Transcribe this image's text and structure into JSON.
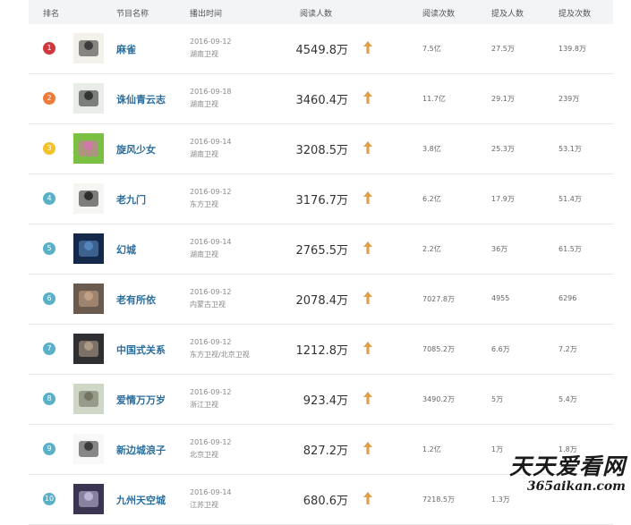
{
  "header": {
    "rank": "排名",
    "name": "节目名称",
    "air_time": "播出时间",
    "readers": "阅读人数",
    "reads": "阅读次数",
    "mentioners": "提及人数",
    "mentions": "提及次数"
  },
  "rows": [
    {
      "rank": "1",
      "name": "麻雀",
      "date": "2016-09-12",
      "channel": "湖南卫视",
      "readers": "4549.8万",
      "reads": "7.5亿",
      "mentioners": "27.5万",
      "mentions": "139.8万",
      "rank_color": "#d0383f"
    },
    {
      "rank": "2",
      "name": "诛仙青云志",
      "date": "2016-09-18",
      "channel": "湖南卫视",
      "readers": "3460.4万",
      "reads": "11.7亿",
      "mentioners": "29.1万",
      "mentions": "239万",
      "rank_color": "#ef7b3a"
    },
    {
      "rank": "3",
      "name": "旋风少女",
      "date": "2016-09-14",
      "channel": "湖南卫视",
      "readers": "3208.5万",
      "reads": "3.8亿",
      "mentioners": "25.3万",
      "mentions": "53.1万",
      "rank_color": "#f3c12b"
    },
    {
      "rank": "4",
      "name": "老九门",
      "date": "2016-09-12",
      "channel": "东方卫视",
      "readers": "3176.7万",
      "reads": "6.2亿",
      "mentioners": "17.9万",
      "mentions": "51.4万",
      "rank_color": "#5ab0c9"
    },
    {
      "rank": "5",
      "name": "幻城",
      "date": "2016-09-14",
      "channel": "湖南卫视",
      "readers": "2765.5万",
      "reads": "2.2亿",
      "mentioners": "36万",
      "mentions": "61.5万",
      "rank_color": "#5ab0c9"
    },
    {
      "rank": "6",
      "name": "老有所依",
      "date": "2016-09-12",
      "channel": "内蒙古卫视",
      "readers": "2078.4万",
      "reads": "7027.8万",
      "mentioners": "4955",
      "mentions": "6296",
      "rank_color": "#5ab0c9"
    },
    {
      "rank": "7",
      "name": "中国式关系",
      "date": "2016-09-12",
      "channel": "东方卫视/北京卫视",
      "readers": "1212.8万",
      "reads": "7085.2万",
      "mentioners": "6.6万",
      "mentions": "7.2万",
      "rank_color": "#5ab0c9"
    },
    {
      "rank": "8",
      "name": "爱情万万岁",
      "date": "2016-09-12",
      "channel": "浙江卫视",
      "readers": "923.4万",
      "reads": "3490.2万",
      "mentioners": "5万",
      "mentions": "5.4万",
      "rank_color": "#5ab0c9"
    },
    {
      "rank": "9",
      "name": "新边城浪子",
      "date": "2016-09-12",
      "channel": "北京卫视",
      "readers": "827.2万",
      "reads": "1.2亿",
      "mentioners": "1万",
      "mentions": "1.8万",
      "rank_color": "#5ab0c9"
    },
    {
      "rank": "10",
      "name": "九州天空城",
      "date": "2016-09-14",
      "channel": "江苏卫视",
      "readers": "680.6万",
      "reads": "7218.5万",
      "mentioners": "1.3万",
      "mentions": "",
      "rank_color": "#5ab0c9"
    }
  ],
  "icons": {
    "trend": "up-arrow-icon",
    "trend_color": "#e0a050"
  },
  "watermark": {
    "line1": "天天爱看网",
    "line2": "365aikan.com"
  }
}
